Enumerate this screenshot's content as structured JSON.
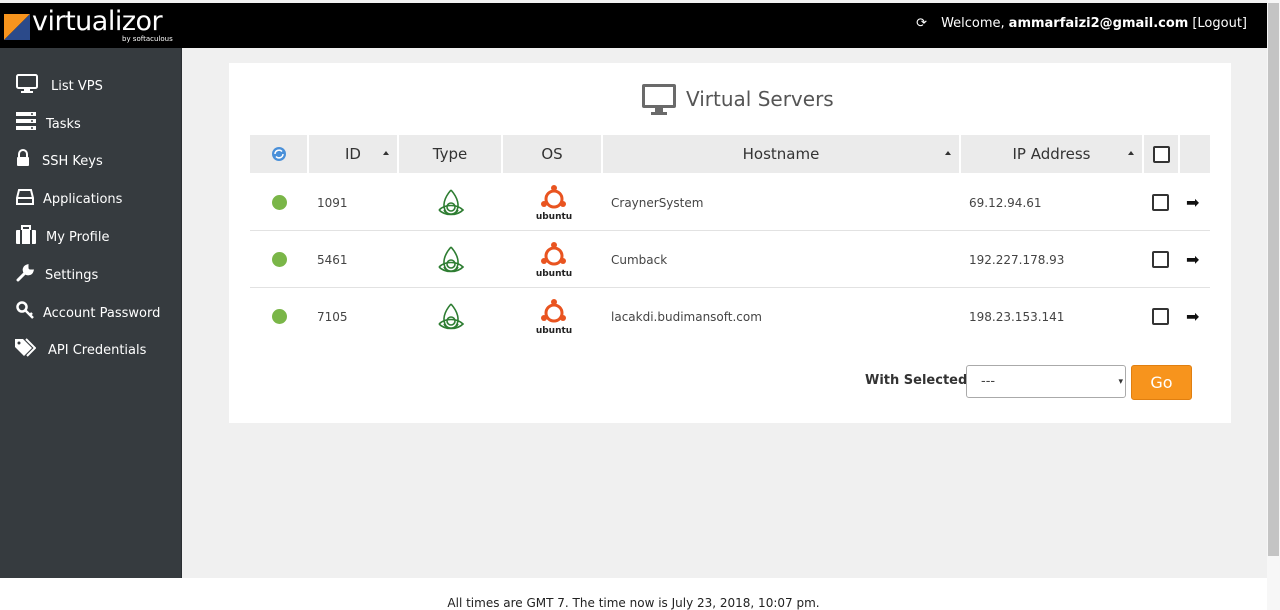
{
  "header": {
    "logo_text": "virtualizor",
    "logo_sub": "by softaculous",
    "welcome_prefix": "Welcome,",
    "user_email": "ammarfaizi2@gmail.com",
    "logout_label": "[Logout]"
  },
  "sidebar": {
    "items": [
      {
        "label": "List VPS",
        "icon": "monitor-icon"
      },
      {
        "label": "Tasks",
        "icon": "tasks-icon"
      },
      {
        "label": "SSH Keys",
        "icon": "lock-icon"
      },
      {
        "label": "Applications",
        "icon": "hdd-icon"
      },
      {
        "label": "My Profile",
        "icon": "briefcase-icon"
      },
      {
        "label": "Settings",
        "icon": "wrench-icon"
      },
      {
        "label": "Account Password",
        "icon": "key-icon"
      },
      {
        "label": "API Credentials",
        "icon": "tags-icon"
      }
    ]
  },
  "main": {
    "title": "Virtual Servers",
    "columns": {
      "id": "ID",
      "type": "Type",
      "os": "OS",
      "hostname": "Hostname",
      "ip": "IP Address"
    },
    "rows": [
      {
        "id": "1091",
        "type": "openvz-icon",
        "os": "ubuntu",
        "hostname": "CraynerSystem",
        "ip": "69.12.94.61"
      },
      {
        "id": "5461",
        "type": "openvz-icon",
        "os": "ubuntu",
        "hostname": "Cumback",
        "ip": "192.227.178.93"
      },
      {
        "id": "7105",
        "type": "openvz-icon",
        "os": "ubuntu",
        "hostname": "lacakdi.budimansoft.com",
        "ip": "198.23.153.141"
      }
    ],
    "with_selected_label": "With Selected:",
    "select_value": "---",
    "go_label": "Go"
  },
  "footer": {
    "text": "All times are GMT 7. The time now is July 23, 2018, 10:07 pm."
  },
  "colors": {
    "accent": "#f7941d",
    "status_online": "#7ab648",
    "sidebar_bg": "#363b3f"
  }
}
